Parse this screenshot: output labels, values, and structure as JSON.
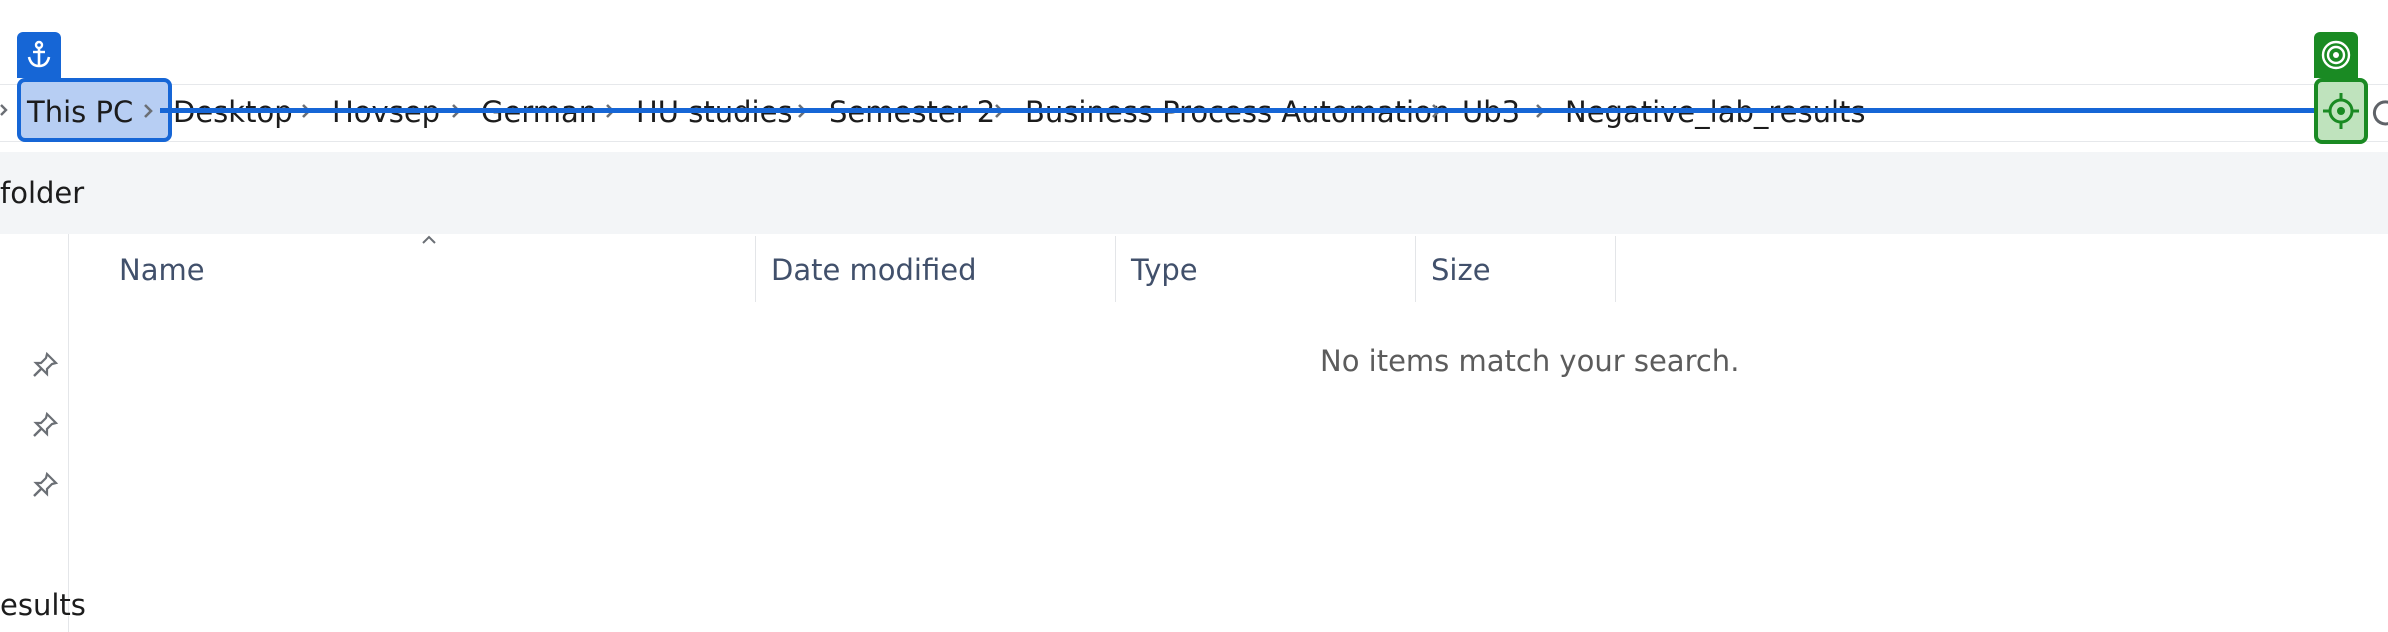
{
  "breadcrumb": {
    "items": [
      {
        "label": "This PC"
      },
      {
        "label": "Desktop"
      },
      {
        "label": "Hovsep"
      },
      {
        "label": "German"
      },
      {
        "label": "HU studies"
      },
      {
        "label": "Semester 2"
      },
      {
        "label": "Business Process Automation"
      },
      {
        "label": "Ub3"
      },
      {
        "label": "Negative_lab_results"
      }
    ]
  },
  "toolbar": {
    "new_folder_label": "folder"
  },
  "nav": {
    "partial_item_label": "esults"
  },
  "columns": {
    "name": "Name",
    "date_modified": "Date modified",
    "type": "Type",
    "size": "Size"
  },
  "content": {
    "empty_message": "No items match your search."
  },
  "overlay": {
    "source_marker_icon": "anchor-icon",
    "target_marker_icon": "bullseye-icon",
    "target_crosshair_icon": "crosshair-icon",
    "source_color": "#1666d6",
    "target_color": "#1a8a23"
  }
}
